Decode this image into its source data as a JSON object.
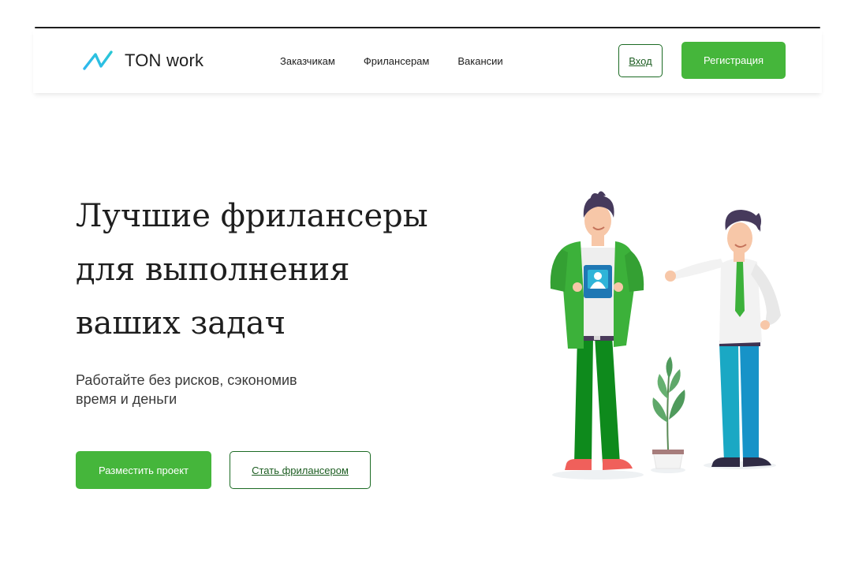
{
  "header": {
    "brand": "TON work",
    "nav": [
      "Заказчикам",
      "Фрилансерам",
      "Вакансии"
    ],
    "login_label": "Вход",
    "register_label": "Регистрация"
  },
  "hero": {
    "title_lines": [
      "Лучшие фрилансеры",
      "для выполнения",
      "ваших задач"
    ],
    "subtitle_lines": [
      "Работайте без рисков, сэкономив",
      "время и деньги"
    ],
    "primary_cta": "Разместить проект",
    "secondary_cta": "Стать фрилансером"
  },
  "colors": {
    "accent": "#45b63b",
    "accent_dark": "#1c6b24",
    "text": "#1e1e1e"
  },
  "icons": {
    "logo": "logo-icon"
  }
}
